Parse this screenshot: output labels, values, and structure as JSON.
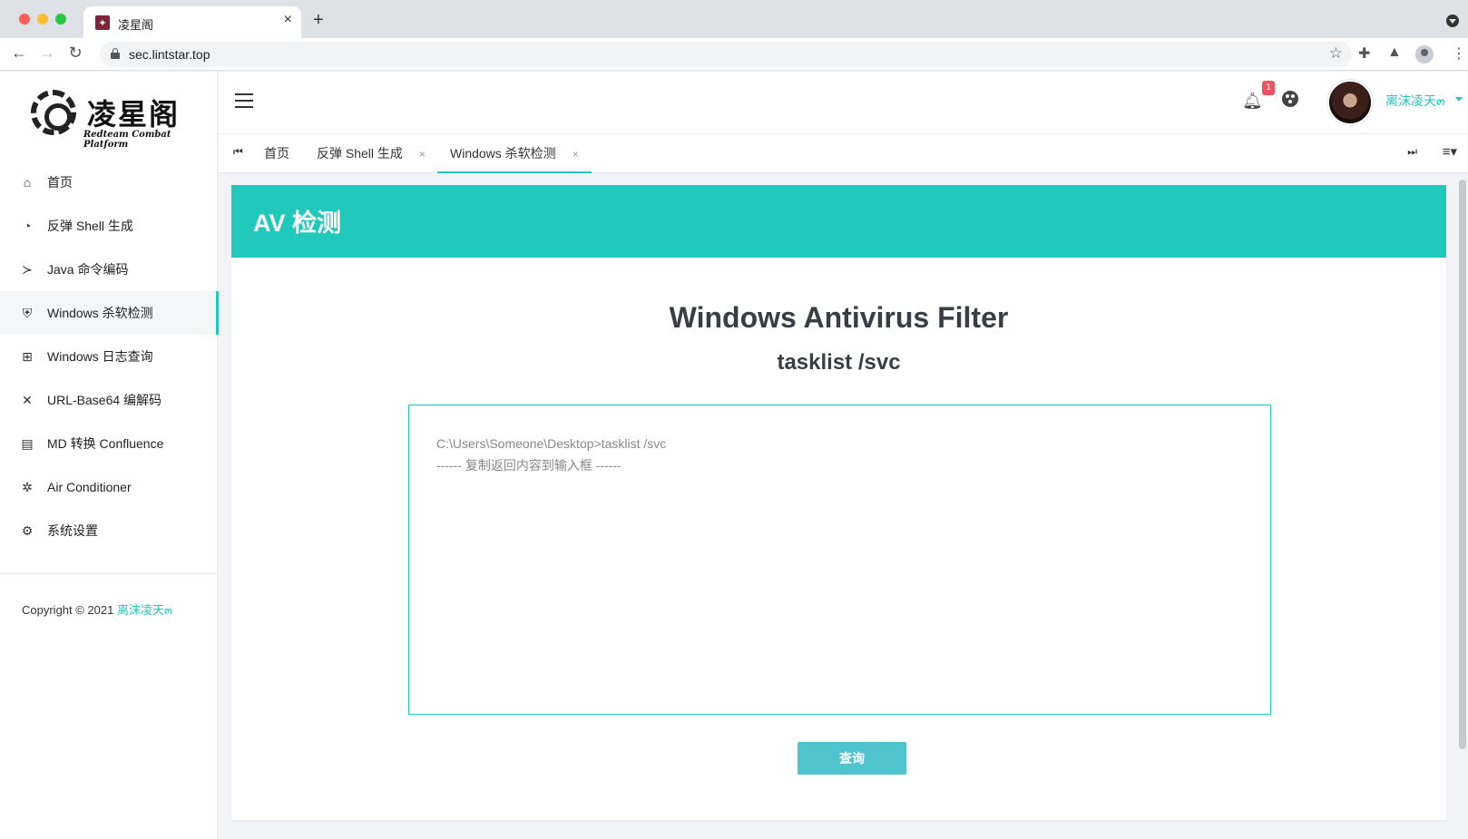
{
  "browser": {
    "tab_title": "凌星阁",
    "url": "sec.lintstar.top"
  },
  "logo": {
    "title": "凌星阁",
    "subtitle": "Redteam Combat Platform"
  },
  "sidebar": {
    "items": [
      {
        "label": "首页",
        "icon": "home-icon"
      },
      {
        "label": "反弹 Shell 生成",
        "icon": "shell-icon"
      },
      {
        "label": "Java 命令编码",
        "icon": "terminal-icon"
      },
      {
        "label": "Windows 杀软检测",
        "icon": "shield-icon",
        "active": true
      },
      {
        "label": "Windows 日志查询",
        "icon": "windows-icon"
      },
      {
        "label": "URL-Base64 编解码",
        "icon": "tools-icon"
      },
      {
        "label": "MD 转换 Confluence",
        "icon": "document-icon"
      },
      {
        "label": "Air Conditioner",
        "icon": "ac-icon"
      },
      {
        "label": "系统设置",
        "icon": "gear-icon"
      }
    ],
    "copyright": "Copyright © 2021",
    "copyright_author": "离沫凌天๓"
  },
  "header": {
    "notification_count": "1",
    "username": "离沫凌天๓"
  },
  "tabs": [
    {
      "label": "首页"
    },
    {
      "label": "反弹 Shell 生成",
      "closable": true
    },
    {
      "label": "Windows 杀软检测",
      "closable": true,
      "active": true
    }
  ],
  "card": {
    "title": "AV 检测",
    "heading": "Windows Antivirus Filter",
    "subheading": "tasklist /svc",
    "placeholder": "C:\\Users\\Someone\\Desktop>tasklist /svc\n------ 复制返回内容到输入框 ------",
    "button_label": "查询"
  },
  "colors": {
    "accent": "#20c9bc",
    "button": "#4fc4cf",
    "badge": "#f0525f"
  }
}
